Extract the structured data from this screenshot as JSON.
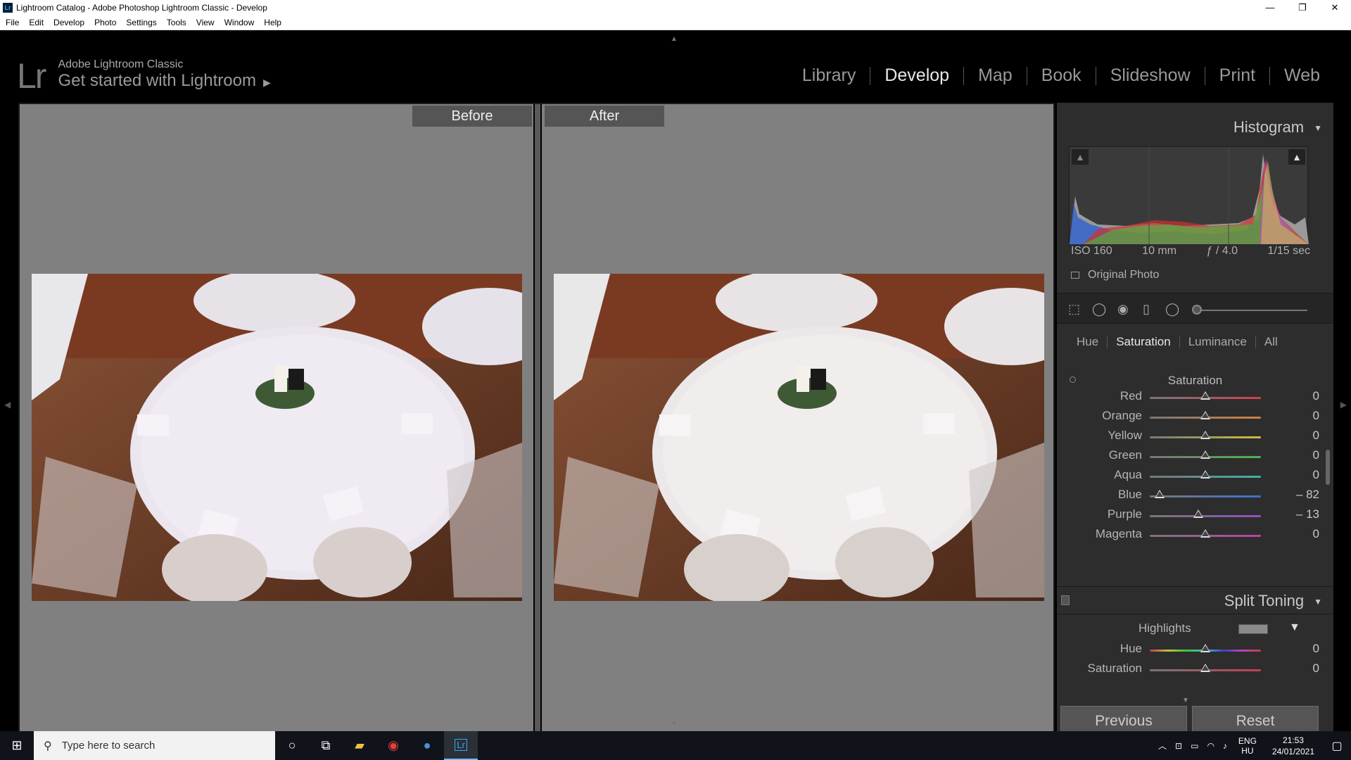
{
  "window": {
    "title": "Lightroom Catalog - Adobe Photoshop Lightroom Classic - Develop",
    "badge": "Lr",
    "controls": [
      "—",
      "❐",
      "✕"
    ]
  },
  "menu": [
    "File",
    "Edit",
    "Develop",
    "Photo",
    "Settings",
    "Tools",
    "View",
    "Window",
    "Help"
  ],
  "identity": {
    "logo": "Lr",
    "product": "Adobe Lightroom Classic",
    "subtitle": "Get started with Lightroom"
  },
  "modules": {
    "items": [
      "Library",
      "Develop",
      "Map",
      "Book",
      "Slideshow",
      "Print",
      "Web"
    ],
    "active": "Develop"
  },
  "view": {
    "before_label": "Before",
    "after_label": "After"
  },
  "histogram": {
    "title": "Histogram",
    "iso": "ISO 160",
    "focal": "10 mm",
    "aperture": "ƒ / 4.0",
    "shutter": "1/15 sec",
    "original_photo": "Original Photo"
  },
  "hsl": {
    "tabs": [
      "Hue",
      "Saturation",
      "Luminance",
      "All"
    ],
    "active_tab": "Saturation",
    "section": "Saturation",
    "sliders": [
      {
        "label": "Red",
        "value": "0",
        "num": 0,
        "gradient": "linear-gradient(to right,#777,#d04050)"
      },
      {
        "label": "Orange",
        "value": "0",
        "num": 0,
        "gradient": "linear-gradient(to right,#777,#d08040)"
      },
      {
        "label": "Yellow",
        "value": "0",
        "num": 0,
        "gradient": "linear-gradient(to right,#777,#c8c040)"
      },
      {
        "label": "Green",
        "value": "0",
        "num": 0,
        "gradient": "linear-gradient(to right,#777,#50b050)"
      },
      {
        "label": "Aqua",
        "value": "0",
        "num": 0,
        "gradient": "linear-gradient(to right,#777,#40b0b0)"
      },
      {
        "label": "Blue",
        "value": "– 82",
        "num": -82,
        "gradient": "linear-gradient(to right,#777,#4070d0)"
      },
      {
        "label": "Purple",
        "value": "– 13",
        "num": -13,
        "gradient": "linear-gradient(to right,#777,#9050c0)"
      },
      {
        "label": "Magenta",
        "value": "0",
        "num": 0,
        "gradient": "linear-gradient(to right,#777,#c040a0)"
      }
    ]
  },
  "split_toning": {
    "title": "Split Toning",
    "highlights_label": "Highlights",
    "sliders": [
      {
        "label": "Hue",
        "value": "0",
        "num": 0,
        "gradient": "linear-gradient(to right,#c04040,#c0c040,#40c040,#40c0c0,#4040c0,#c040c0,#c04040)"
      },
      {
        "label": "Saturation",
        "value": "0",
        "num": 0,
        "gradient": "linear-gradient(to right,#777,#c04050)"
      }
    ]
  },
  "buttons": {
    "previous": "Previous",
    "reset": "Reset"
  },
  "taskbar": {
    "search_placeholder": "Type here to search",
    "lang_top": "ENG",
    "lang_bottom": "HU",
    "time": "21:53",
    "date": "24/01/2021"
  }
}
